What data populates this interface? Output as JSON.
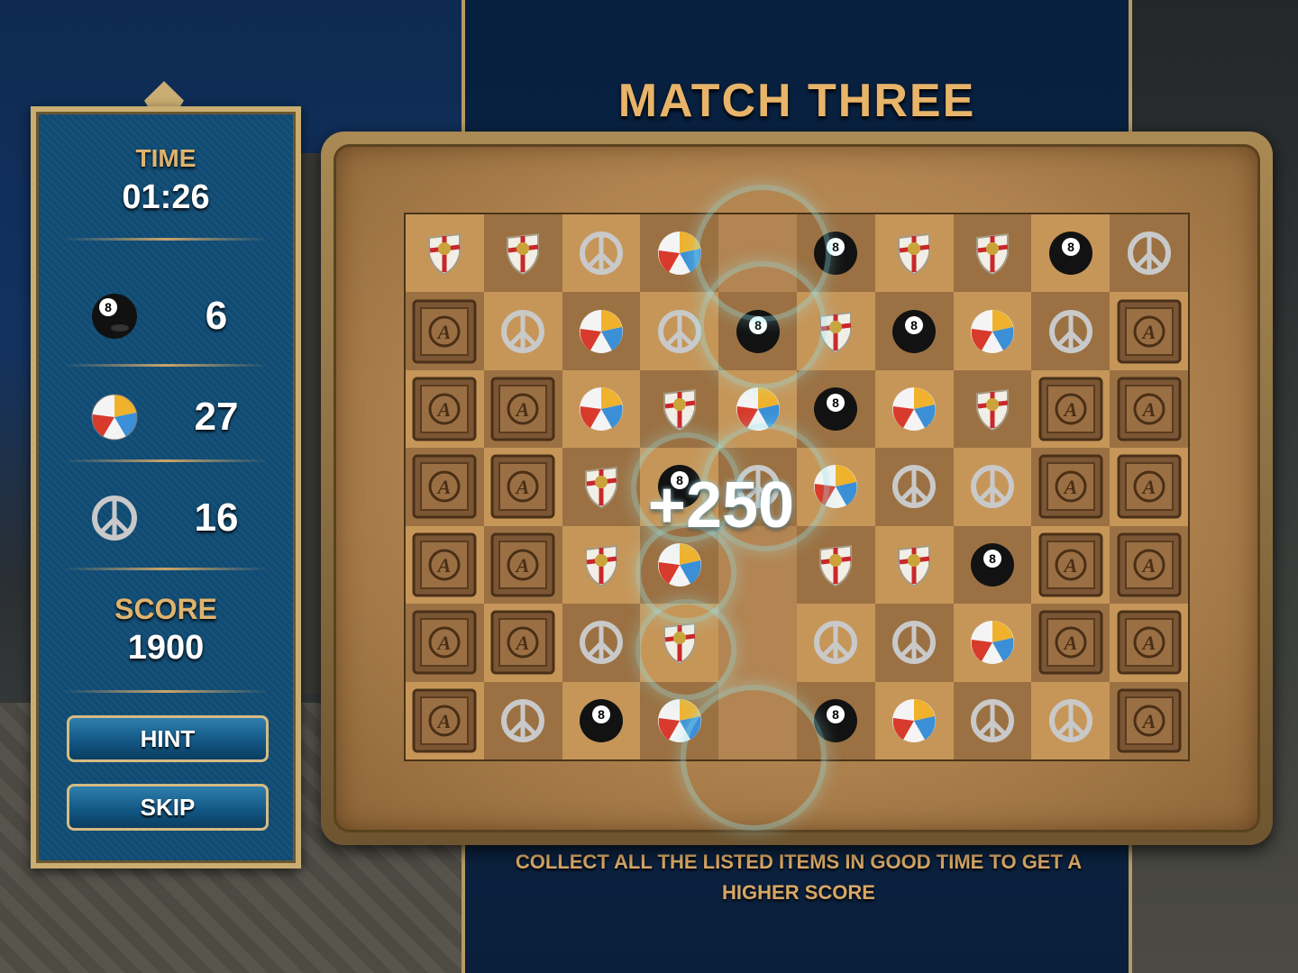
{
  "game": {
    "title": "MATCH THREE",
    "instructions": "COLLECT ALL THE LISTED ITEMS IN GOOD TIME TO GET A HIGHER SCORE"
  },
  "info_panel": {
    "time_label": "TIME",
    "time_value": "01:26",
    "goals": [
      {
        "icon": "eight-ball",
        "count": "6"
      },
      {
        "icon": "beach-ball",
        "count": "27"
      },
      {
        "icon": "peace-symbol",
        "count": "16"
      }
    ],
    "score_label": "SCORE",
    "score_value": "1900",
    "hint_label": "HINT",
    "skip_label": "SKIP"
  },
  "board": {
    "popup": "+250",
    "rows": [
      [
        "shield",
        "shield",
        "peace",
        "beachball",
        "empty",
        "eightball",
        "shield",
        "shield",
        "eightball",
        "peace"
      ],
      [
        "block",
        "peace",
        "beachball",
        "peace",
        "eightball",
        "shield",
        "eightball",
        "beachball",
        "peace",
        "block"
      ],
      [
        "block",
        "block",
        "beachball",
        "shield",
        "beachball",
        "eightball",
        "beachball",
        "shield",
        "block",
        "block"
      ],
      [
        "block",
        "block",
        "shield",
        "eightball",
        "peace",
        "beachball",
        "peace",
        "peace",
        "block",
        "block"
      ],
      [
        "block",
        "block",
        "shield",
        "beachball",
        "empty",
        "shield",
        "shield",
        "eightball",
        "block",
        "block"
      ],
      [
        "block",
        "block",
        "peace",
        "shield",
        "empty",
        "peace",
        "peace",
        "beachball",
        "block",
        "block"
      ],
      [
        "block",
        "peace",
        "eightball",
        "beachball",
        "empty",
        "eightball",
        "beachball",
        "peace",
        "peace",
        "block"
      ]
    ],
    "cell_shades": [
      [
        "light",
        "dark",
        "light",
        "dark",
        "empty",
        "dark",
        "light",
        "dark",
        "light",
        "dark"
      ],
      [
        "dark",
        "light",
        "dark",
        "light",
        "dark",
        "light",
        "dark",
        "light",
        "dark",
        "light"
      ],
      [
        "light",
        "dark",
        "light",
        "dark",
        "light",
        "dark",
        "light",
        "dark",
        "light",
        "dark"
      ],
      [
        "dark",
        "light",
        "dark",
        "light",
        "dark",
        "light",
        "dark",
        "light",
        "dark",
        "light"
      ],
      [
        "light",
        "dark",
        "light",
        "dark",
        "light",
        "dark",
        "light",
        "dark",
        "light",
        "dark"
      ],
      [
        "dark",
        "light",
        "dark",
        "light",
        "dark",
        "light",
        "dark",
        "light",
        "dark",
        "light"
      ],
      [
        "light",
        "dark",
        "light",
        "dark",
        "light",
        "dark",
        "light",
        "dark",
        "light",
        "dark"
      ]
    ]
  },
  "colors": {
    "gold": "#dfb36e",
    "panel_blue": "#0f4a72",
    "board_tan": "#c69659"
  }
}
